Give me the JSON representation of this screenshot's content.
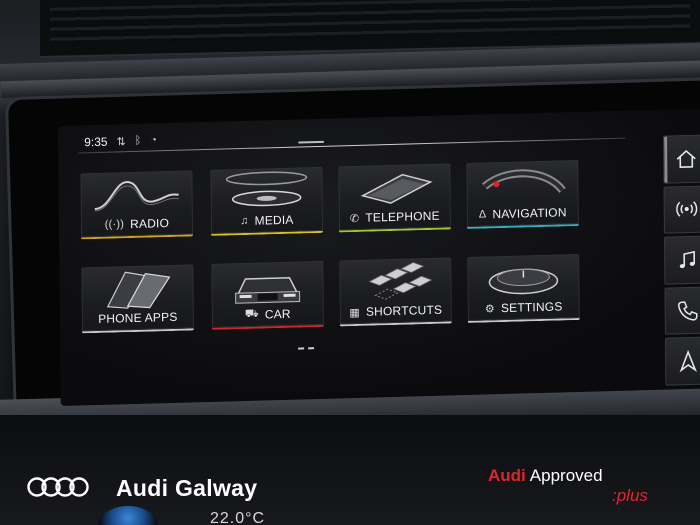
{
  "status_bar": {
    "time": "9:35",
    "icons": [
      "network-icon",
      "bluetooth-icon",
      "wireless-charging-icon"
    ]
  },
  "tiles": [
    {
      "key": "radio",
      "label": "RADIO",
      "icon": "radio-antenna-icon",
      "accent": "#d6a11e"
    },
    {
      "key": "media",
      "label": "MEDIA",
      "icon": "music-note-icon",
      "accent": "#d8c21f"
    },
    {
      "key": "telephone",
      "label": "TELEPHONE",
      "icon": "phone-handset-icon",
      "accent": "#a7c72f"
    },
    {
      "key": "navigation",
      "label": "NAVIGATION",
      "icon": "navigation-arrow-icon",
      "accent": "#2bb5c5"
    },
    {
      "key": "phone_apps",
      "label": "PHONE APPS",
      "icon": "phone-apps-icon",
      "accent": "#c9c9c9"
    },
    {
      "key": "car",
      "label": "CAR",
      "icon": "car-icon",
      "accent": "#d3242d"
    },
    {
      "key": "shortcuts",
      "label": "SHORTCUTS",
      "icon": "grid-icon",
      "accent": "#c9c9c9"
    },
    {
      "key": "settings",
      "label": "SETTINGS",
      "icon": "gear-icon",
      "accent": "#c9c9c9"
    }
  ],
  "rail": [
    "home-icon",
    "radio-signal-icon",
    "music-note-icon",
    "phone-handset-icon",
    "navigation-arrow-icon"
  ],
  "watermark": {
    "dealer": "Audi Galway",
    "approved_brand": "Audi",
    "approved_text": "Approved",
    "approved_suffix": ":plus"
  },
  "lower_display": "22.0°C",
  "colors": {
    "audi_red": "#e3232c",
    "screen_bg": "#0b0b0d"
  }
}
